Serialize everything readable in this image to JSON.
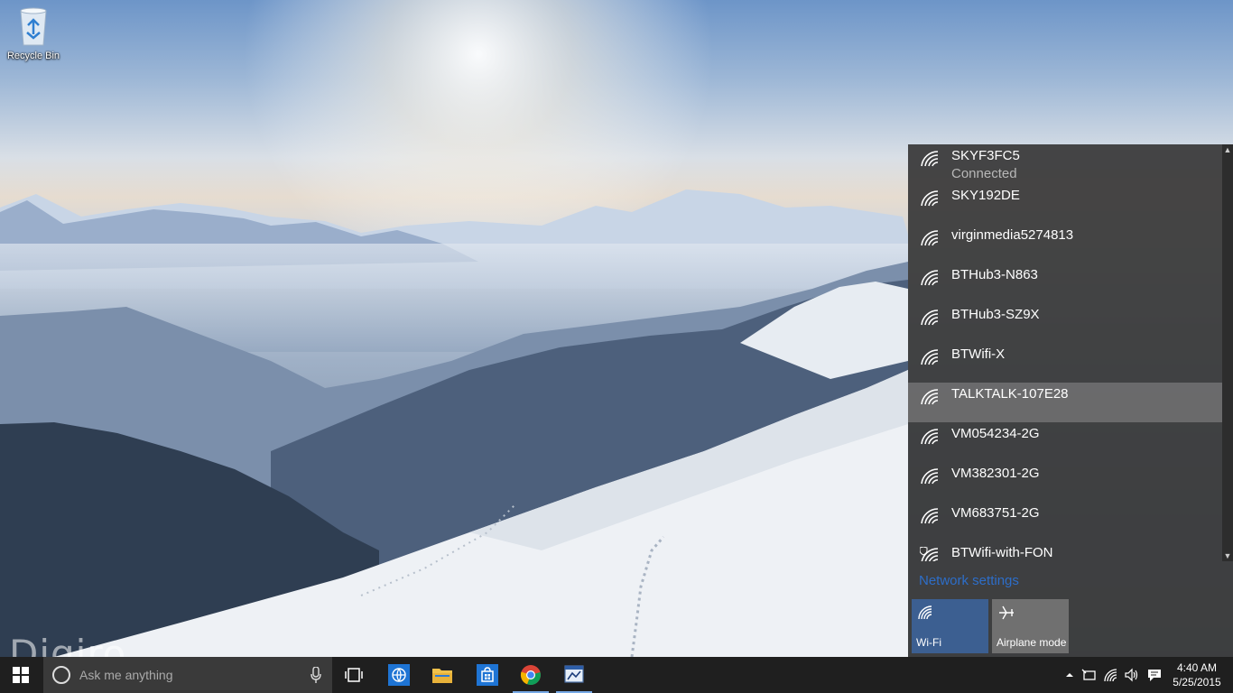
{
  "desktop": {
    "icons": [
      {
        "label": "Recycle Bin",
        "icon": "recycle-bin-icon"
      }
    ]
  },
  "network_flyout": {
    "networks": [
      {
        "name": "SKYF3FC5",
        "status": "Connected"
      },
      {
        "name": "SKY192DE"
      },
      {
        "name": "virginmedia5274813"
      },
      {
        "name": "BTHub3-N863"
      },
      {
        "name": "BTHub3-SZ9X"
      },
      {
        "name": "BTWifi-X"
      },
      {
        "name": "TALKTALK-107E28"
      },
      {
        "name": "VM054234-2G"
      },
      {
        "name": "VM382301-2G"
      },
      {
        "name": "VM683751-2G"
      },
      {
        "name": "BTWifi-with-FON",
        "secured_badge": true
      }
    ],
    "settings_link": "Network settings",
    "quick_actions": [
      {
        "label": "Wi-Fi",
        "icon": "wifi-icon",
        "active": true
      },
      {
        "label": "Airplane mode",
        "icon": "airplane-icon",
        "active": false
      }
    ]
  },
  "taskbar": {
    "search_placeholder": "Ask me anything",
    "pinned": [
      "task-view-icon",
      "edge-icon",
      "file-explorer-icon",
      "store-icon",
      "chrome-icon",
      "app-icon"
    ],
    "clock": {
      "time": "4:40 AM",
      "date": "5/25/2015"
    }
  },
  "watermark": "Digiro",
  "colors": {
    "flyout_bg": "#3a3a3a",
    "accent": "#3c5f91",
    "link": "#2d6ec9",
    "taskbar_bg": "#1f1f1f"
  }
}
